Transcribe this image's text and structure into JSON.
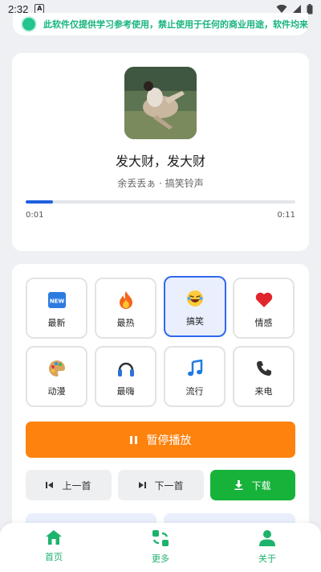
{
  "status_bar": {
    "time": "2:32",
    "notif_icon": "a-icon"
  },
  "notice": {
    "text": "此软件仅提供学习参考使用，禁止使用于任何的商业用途，软件均来"
  },
  "player": {
    "title": "发大财，发大财",
    "meta": "余丢丢ぁ · 搞笑铃声",
    "current_time": "0:01",
    "total_time": "0:11",
    "progress": 0.1
  },
  "categories": [
    {
      "label": "最新",
      "icon": "new-badge-icon",
      "active": false
    },
    {
      "label": "最热",
      "icon": "fire-icon",
      "active": false
    },
    {
      "label": "搞笑",
      "icon": "laughing-face-icon",
      "active": true
    },
    {
      "label": "情感",
      "icon": "heart-icon",
      "active": false
    },
    {
      "label": "动漫",
      "icon": "palette-icon",
      "active": false
    },
    {
      "label": "最嗨",
      "icon": "headphones-icon",
      "active": false
    },
    {
      "label": "流行",
      "icon": "music-note-icon",
      "active": false
    },
    {
      "label": "来电",
      "icon": "phone-icon",
      "active": false
    }
  ],
  "controls": {
    "pause_label": "暂停播放",
    "prev_label": "上一首",
    "next_label": "下一首",
    "download_label": "下载"
  },
  "nav": {
    "home": "首页",
    "more": "更多",
    "about": "关于"
  },
  "colors": {
    "accent_blue": "#1f5fe0",
    "orange": "#fd820e",
    "green_button": "#17b23a",
    "nav_green": "#1db36d"
  }
}
